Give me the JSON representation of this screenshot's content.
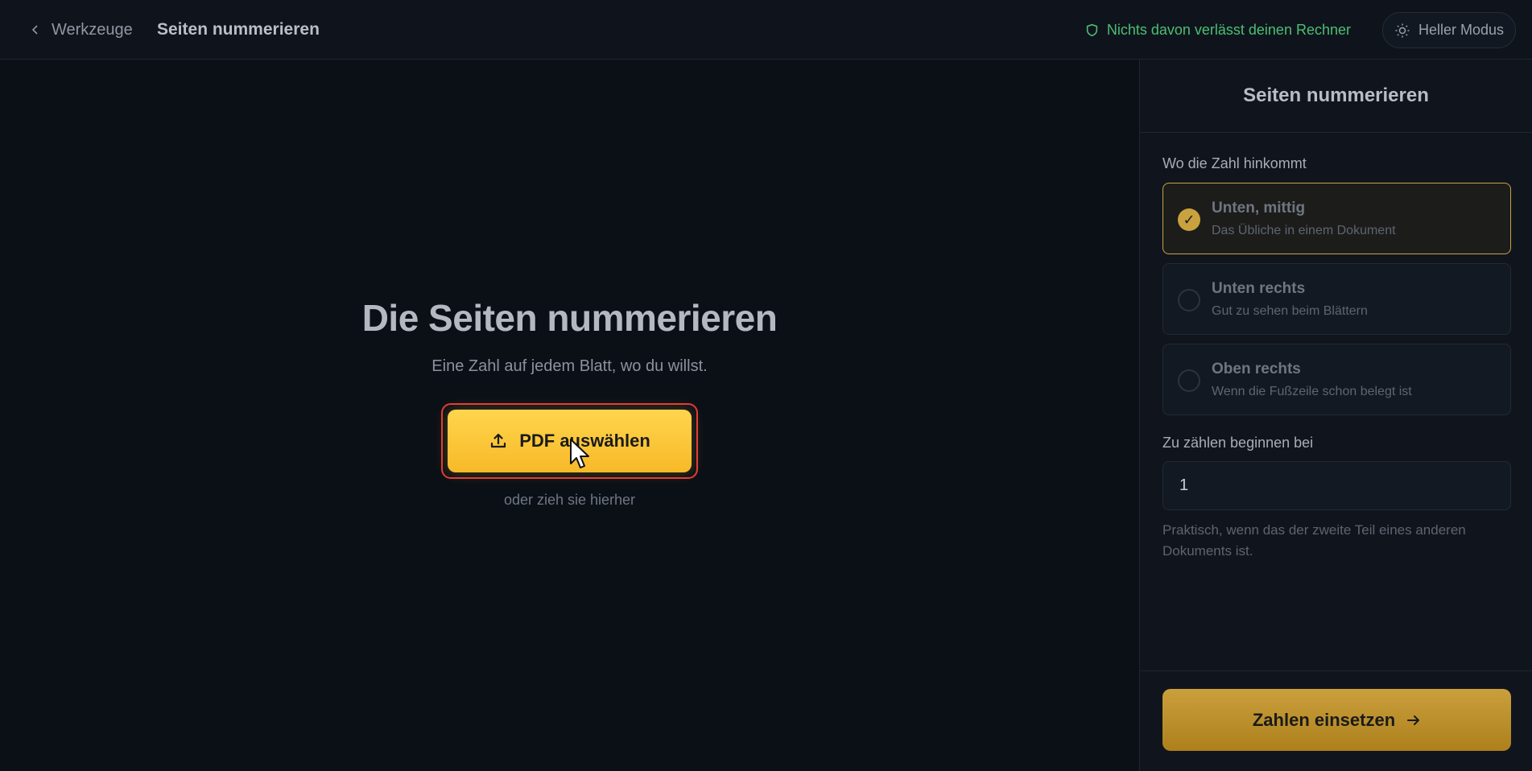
{
  "header": {
    "back_label": "Werkzeuge",
    "title": "Seiten nummerieren",
    "privacy_text": "Nichts davon verlässt deinen Rechner",
    "mode_label": "Heller Modus"
  },
  "main": {
    "title": "Die Seiten nummerieren",
    "subtitle": "Eine Zahl auf jedem Blatt, wo du willst.",
    "pick_button": "PDF auswählen",
    "drop_hint": "oder zieh sie hierher"
  },
  "sidebar": {
    "title": "Seiten nummerieren",
    "position_label": "Wo die Zahl hinkommt",
    "options": [
      {
        "title": "Unten, mittig",
        "desc": "Das Übliche in einem Dokument",
        "selected": true
      },
      {
        "title": "Unten rechts",
        "desc": "Gut zu sehen beim Blättern",
        "selected": false
      },
      {
        "title": "Oben rechts",
        "desc": "Wenn die Fußzeile schon belegt ist",
        "selected": false
      }
    ],
    "start_label": "Zu zählen beginnen bei",
    "start_value": "1",
    "start_hint": "Praktisch, wenn das der zweite Teil eines anderen Dokuments ist.",
    "submit_label": "Zahlen einsetzen",
    "check_glyph": "✓"
  },
  "colors": {
    "accent": "#ffc83d",
    "privacy_green": "#4bbf73",
    "highlight_red": "#e53935"
  }
}
